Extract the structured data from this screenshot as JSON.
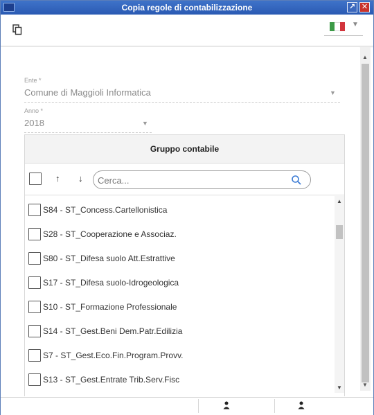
{
  "window": {
    "title": "Copia regole di contabilizzazione"
  },
  "toolbar": {
    "copy_icon": "copy-icon",
    "language_flag": "italy-flag-icon",
    "flag_colors": [
      "#3c9a47",
      "#ffffff",
      "#d2343c"
    ]
  },
  "form": {
    "ente": {
      "label": "Ente *",
      "value": "Comune di Maggioli Informatica"
    },
    "anno": {
      "label": "Anno *",
      "value": "2018"
    }
  },
  "group": {
    "header": "Gruppo contabile",
    "sort_up": "↑",
    "sort_down": "↓",
    "search": {
      "placeholder": "Cerca..."
    },
    "items": [
      {
        "label": "S84 - ST_Concess.Cartellonistica"
      },
      {
        "label": "S28 - ST_Cooperazione e Associaz."
      },
      {
        "label": "S80 - ST_Difesa suolo Att.Estrattive"
      },
      {
        "label": "S17 - ST_Difesa suolo-Idrogeologica"
      },
      {
        "label": "S10 - ST_Formazione Professionale"
      },
      {
        "label": "S14 - ST_Gest.Beni Dem.Patr.Edilizia"
      },
      {
        "label": "S7 - ST_Gest.Eco.Fin.Program.Provv."
      },
      {
        "label": "S13 - ST_Gest.Entrate Trib.Serv.Fisc"
      }
    ]
  },
  "status": {
    "icons": [
      "user-icon",
      "user-icon"
    ]
  },
  "colors": {
    "titlebar": "#2f62bd",
    "close": "#c9332b"
  }
}
